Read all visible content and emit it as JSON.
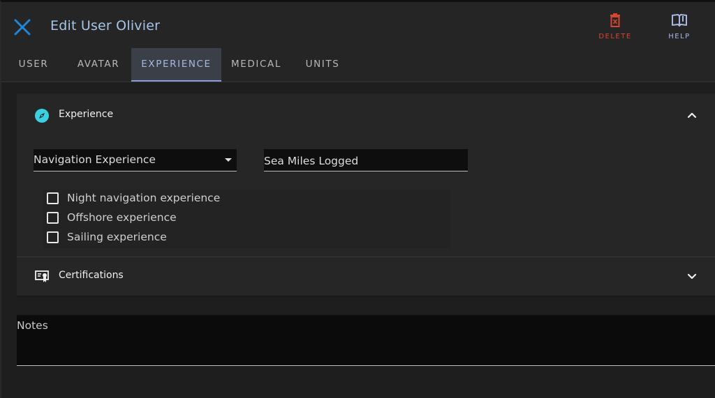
{
  "header": {
    "title": "Edit User Olivier",
    "delete_label": "DELETE",
    "help_label": "HELP"
  },
  "tabs": [
    {
      "label": "USER",
      "active": false
    },
    {
      "label": "AVATAR",
      "active": false
    },
    {
      "label": "EXPERIENCE",
      "active": true
    },
    {
      "label": "MEDICAL",
      "active": false
    },
    {
      "label": "UNITS",
      "active": false
    }
  ],
  "experience_panel": {
    "title": "Experience",
    "expanded": true,
    "select": {
      "value": "Navigation Experience"
    },
    "sea_miles": {
      "placeholder": "Sea Miles Logged",
      "value": ""
    },
    "checkboxes": [
      {
        "label": "Night navigation experience",
        "checked": false
      },
      {
        "label": "Offshore experience",
        "checked": false
      },
      {
        "label": "Sailing experience",
        "checked": false
      }
    ]
  },
  "certifications_panel": {
    "title": "Certifications",
    "expanded": false
  },
  "notes": {
    "label": "Notes",
    "value": ""
  },
  "colors": {
    "accent": "#a8b8e0",
    "close_icon": "#1e88d4",
    "delete": "#d8452f",
    "compass_icon": "#3ad0e0"
  }
}
